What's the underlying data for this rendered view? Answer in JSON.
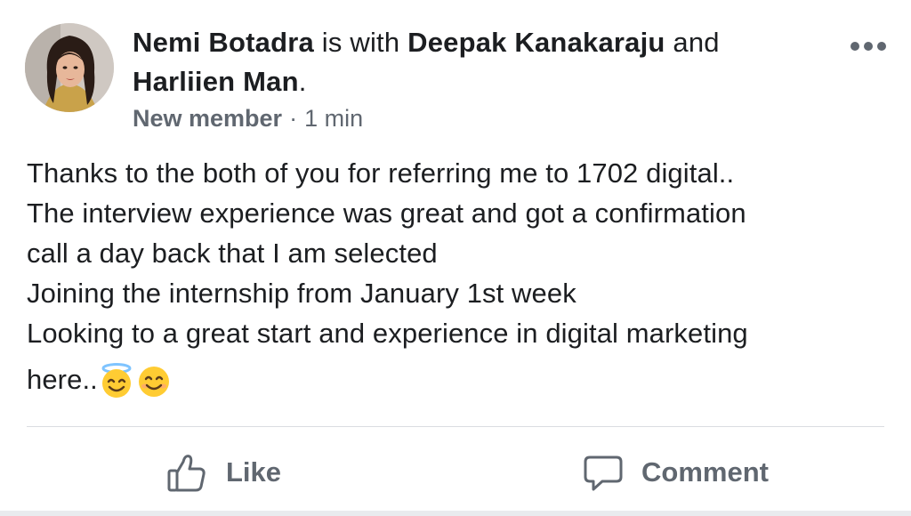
{
  "post": {
    "author": "Nemi Botadra",
    "with_text": " is with ",
    "tagged_1": "Deepak Kanakaraju",
    "and_text": " and ",
    "tagged_2": "Harliien Man",
    "end_punct": ".",
    "role": "New member",
    "separator": "·",
    "time": "1 min",
    "body_lines": [
      "Thanks to the both of you for referring me to 1702 digital..",
      "The interview experience was great and got a confirmation",
      "call a day back that I am selected",
      "Joining the internship from January 1st week",
      "Looking to a great start and experience in digital marketing",
      "here.."
    ],
    "emojis": [
      "smiling-face-with-halo",
      "smiling-face"
    ]
  },
  "actions": {
    "like_label": "Like",
    "comment_label": "Comment"
  },
  "colors": {
    "text": "#1c1e21",
    "secondary": "#606770",
    "divider": "#dadde1",
    "emoji_yellow": "#ffcc33",
    "halo_blue": "#7fc4ff"
  }
}
